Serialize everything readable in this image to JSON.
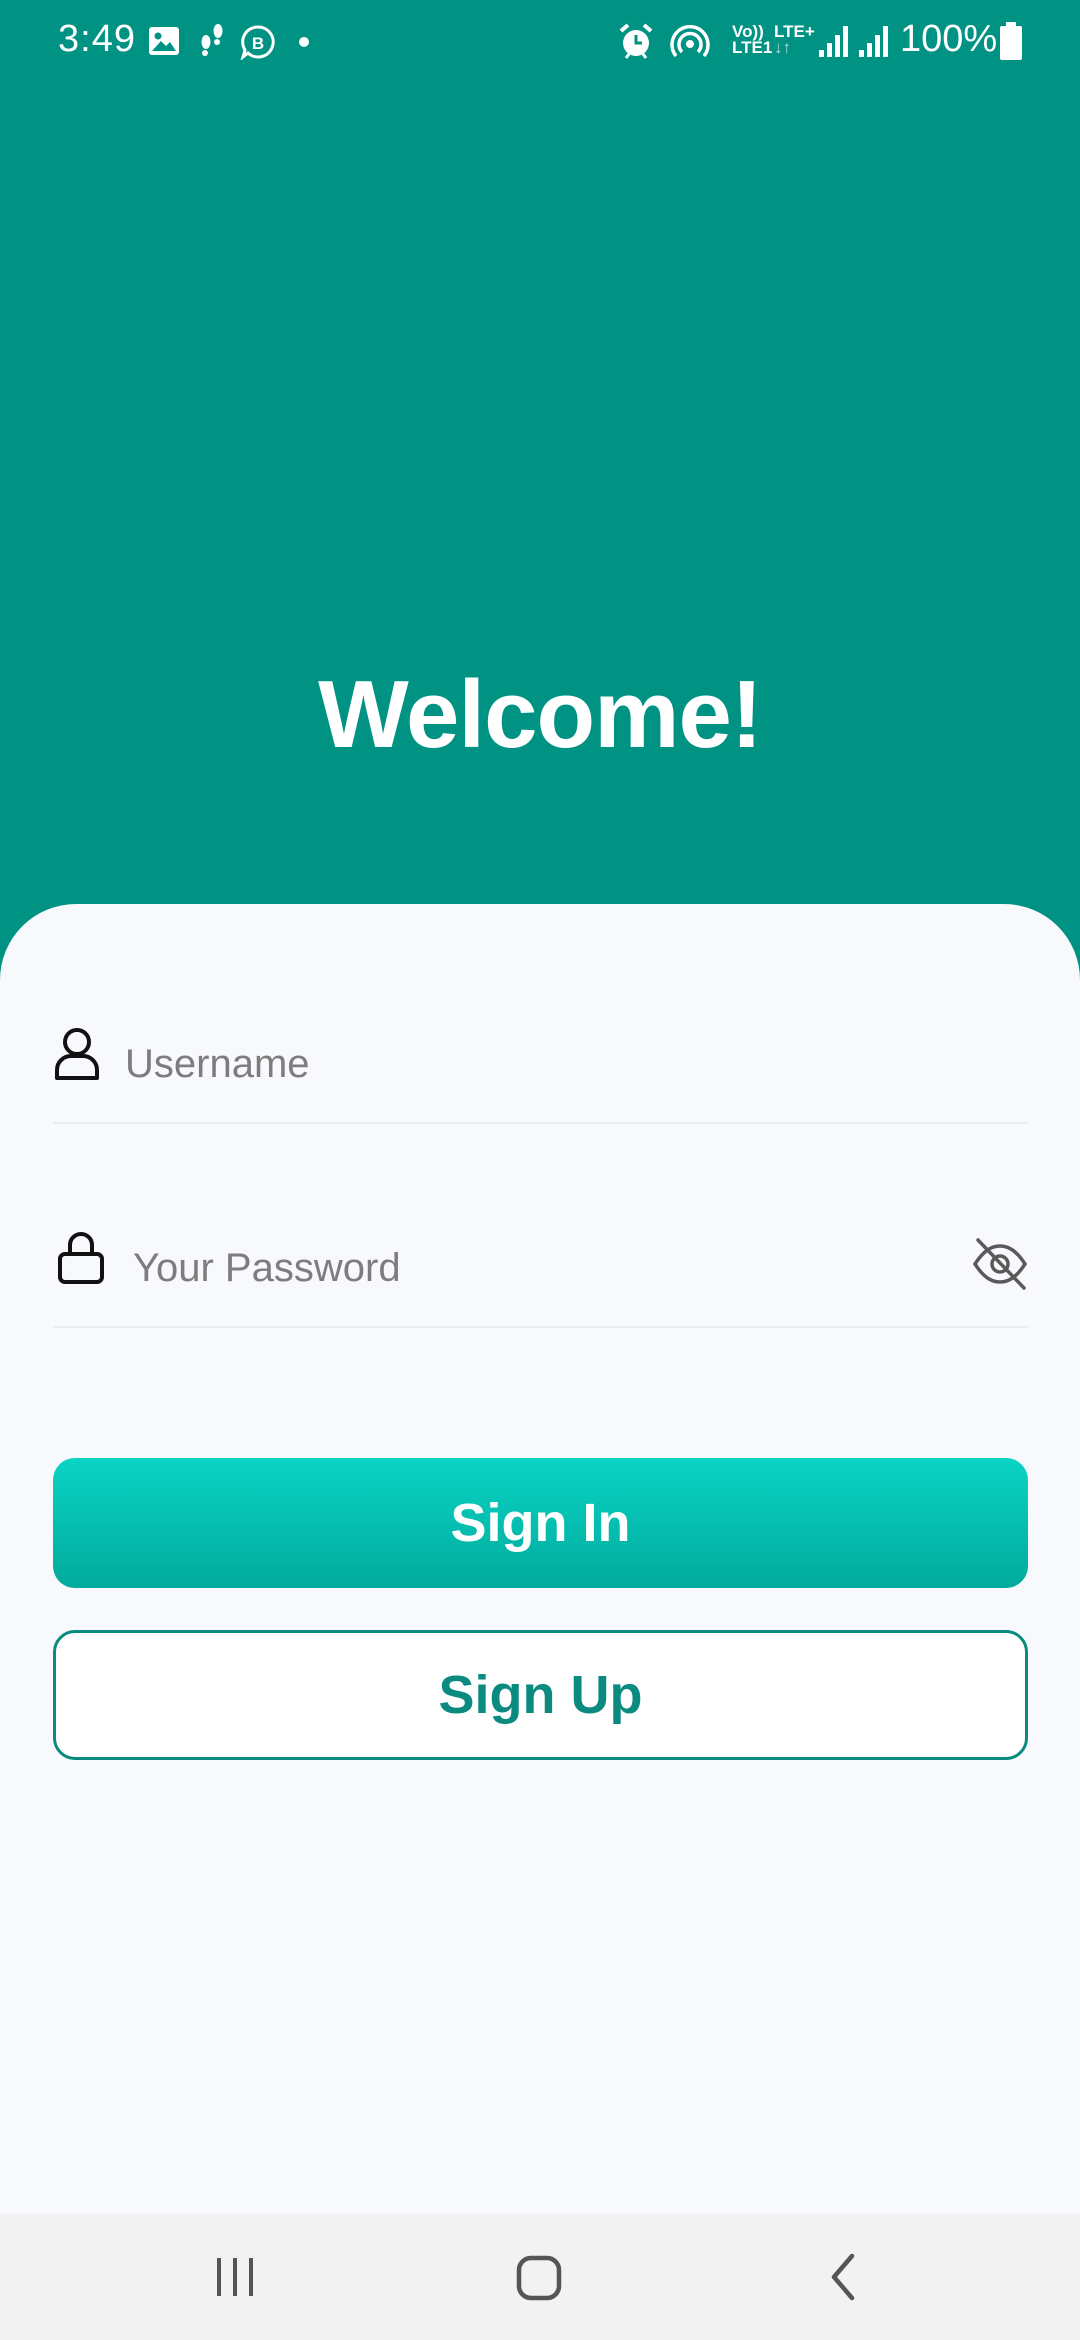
{
  "status_bar": {
    "time": "3:49",
    "battery": "100%",
    "volte_top": "Vo))",
    "volte_bottom": "LTE1",
    "lte_top": "LTE+",
    "lte_arrows": "↓↑"
  },
  "header": {
    "title": "Welcome!"
  },
  "form": {
    "username": {
      "placeholder": "Username",
      "value": "",
      "icon": "user-icon"
    },
    "password": {
      "placeholder": "Your Password",
      "value": "",
      "icon": "lock-icon",
      "toggle_icon": "eye-off-icon"
    }
  },
  "buttons": {
    "sign_in": "Sign In",
    "sign_up": "Sign Up"
  },
  "nav": {
    "recents": "recents-icon",
    "home": "home-icon",
    "back": "back-icon"
  },
  "colors": {
    "header_bg": "#009283",
    "card_bg": "#f7f9fc",
    "primary_gradient_top": "#0ad4c4",
    "primary_gradient_bottom": "#01aa9c",
    "outline": "#0b8b80"
  }
}
